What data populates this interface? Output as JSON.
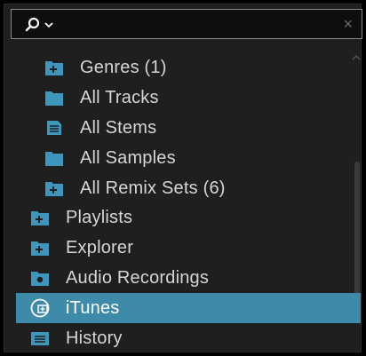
{
  "search": {
    "placeholder": "",
    "clear_label": "×"
  },
  "tree": {
    "items": [
      {
        "label": "Genres (1)",
        "icon": "folder-add-icon"
      },
      {
        "label": "All Tracks",
        "icon": "folder-icon"
      },
      {
        "label": "All Stems",
        "icon": "stems-icon"
      },
      {
        "label": "All Samples",
        "icon": "folder-icon"
      },
      {
        "label": "All Remix Sets (6)",
        "icon": "folder-add-icon"
      },
      {
        "label": "Playlists",
        "icon": "folder-add-icon"
      },
      {
        "label": "Explorer",
        "icon": "folder-add-icon"
      },
      {
        "label": "Audio Recordings",
        "icon": "record-folder-icon"
      },
      {
        "label": "iTunes",
        "icon": "itunes-icon",
        "selected": true
      },
      {
        "label": "History",
        "icon": "history-icon"
      }
    ]
  },
  "colors": {
    "accent": "#3d8ba8",
    "icon": "#3f96bb"
  }
}
